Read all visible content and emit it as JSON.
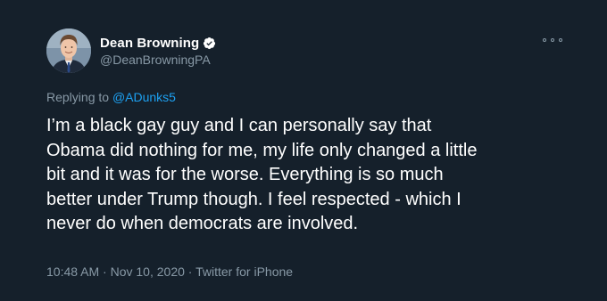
{
  "author": {
    "display_name": "Dean Browning",
    "handle": "@DeanBrowningPA",
    "verified": true
  },
  "reply": {
    "prefix": "Replying to",
    "target": "@ADunks5"
  },
  "tweet_lines": [
    "I’m a black gay guy and I can personally say that",
    "Obama did nothing for me, my life only changed a little",
    "bit and it was for the worse. Everything is so much",
    "better under Trump though. I feel respected - which I",
    "never do when democrats are involved."
  ],
  "meta": {
    "time": "10:48 AM",
    "date": "Nov 10, 2020",
    "source": "Twitter for iPhone",
    "separator": "·"
  },
  "icons": {
    "verified": "verified-badge-icon",
    "more": "more-options-icon"
  },
  "colors": {
    "background": "#15202b",
    "primary_text": "#ffffff",
    "secondary_text": "#8899a6",
    "link": "#1da1f2"
  }
}
